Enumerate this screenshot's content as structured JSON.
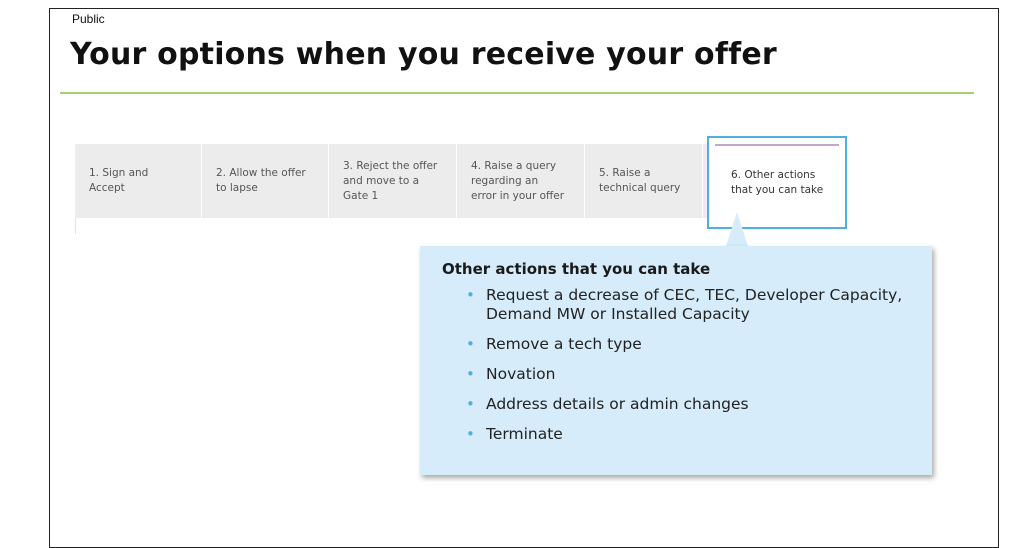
{
  "header": {
    "classification": "Public",
    "title": "Your options when you receive your offer"
  },
  "tabs": [
    {
      "label": "1. Sign and\nAccept",
      "active": false
    },
    {
      "label": "2. Allow the offer\nto lapse",
      "active": false
    },
    {
      "label": "3. Reject the offer\nand move to a\nGate 1",
      "active": false
    },
    {
      "label": "4. Raise a query\nregarding an\nerror in your offer",
      "active": false
    },
    {
      "label": "5. Raise a\ntechnical query",
      "active": false
    },
    {
      "label": "6. Other actions\nthat you can take",
      "active": true
    }
  ],
  "callout": {
    "title": "Other actions that you can take",
    "items": [
      "Request a decrease of CEC, TEC, Developer Capacity, Demand MW or Installed Capacity",
      "Remove a tech type",
      "Novation",
      "Address details or admin changes",
      "Terminate"
    ]
  },
  "colors": {
    "accent_rule": "#a6cf73",
    "active_tab_border": "#4db0e0",
    "callout_background": "#d6ecfa",
    "bullet": "#4db0e0"
  }
}
